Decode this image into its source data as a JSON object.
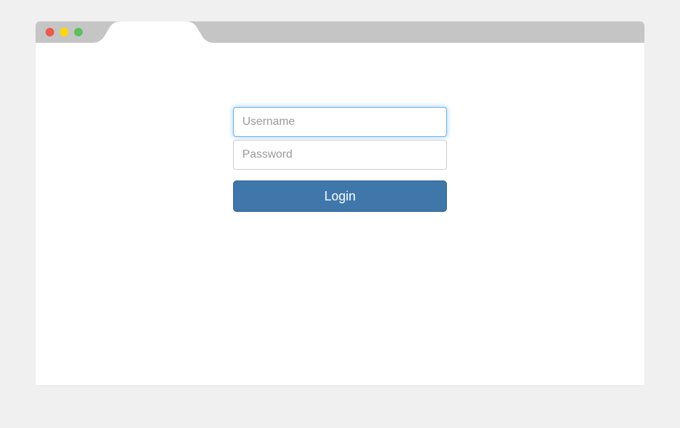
{
  "login": {
    "username_placeholder": "Username",
    "password_placeholder": "Password",
    "button_label": "Login"
  }
}
